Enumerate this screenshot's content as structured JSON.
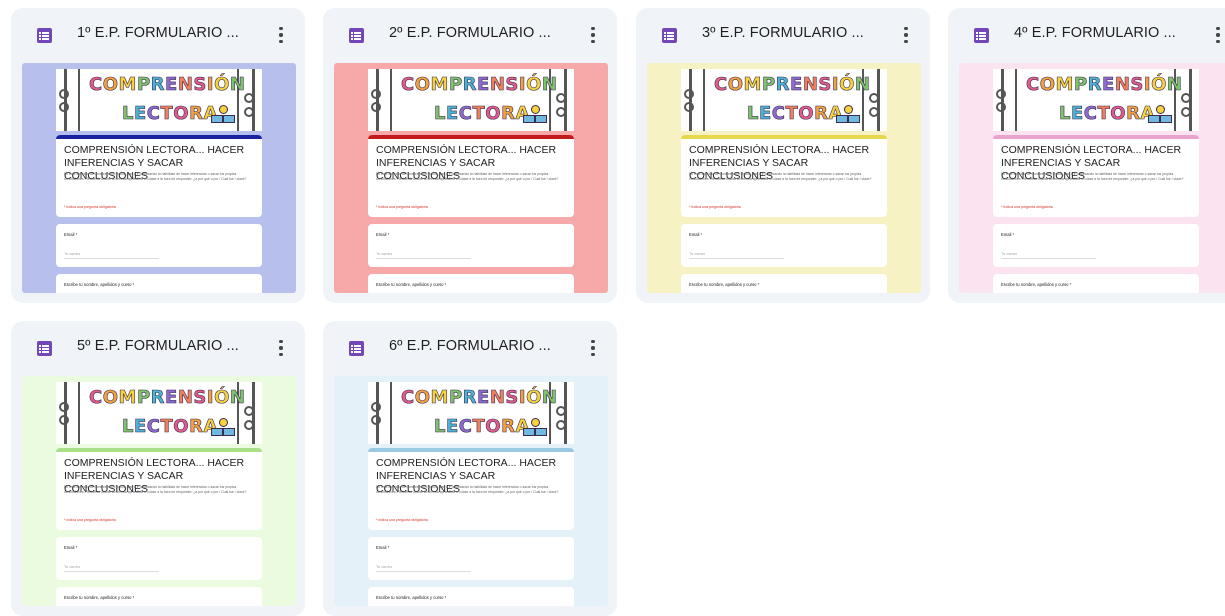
{
  "cards": [
    {
      "title": "1º E.P. FORMULARIO ...",
      "theme_bg": "#b7c0ec",
      "accent": "#1a22a0",
      "form": {
        "banner_word1": "COMPRENSIÓN",
        "banner_word2": "LECTORA",
        "heading": "COMPRENSIÓN LECTORA... HACER INFERENCIAS Y SACAR CONCLUSIONES",
        "description": "En este ejercicio de Comprensión lectora, vas a ir practicando la habilidad de hacer inferencias o sacar tus propias conclusiones. Recuerda utilizar la fórmula aprendida en clase a la hora de responder: ¿a por qué o por / Cuál fue / clave?",
        "required_note": "* Indica una pregunta obligatoria",
        "email_label": "Email *",
        "email_placeholder": "Tu correo",
        "name_label": "Escribe tu nombre, apellidos y curso *"
      }
    },
    {
      "title": "2º E.P. FORMULARIO ...",
      "theme_bg": "#f7a8a8",
      "accent": "#c21b1b",
      "form": {
        "banner_word1": "COMPRENSIÓN",
        "banner_word2": "LECTORA",
        "heading": "COMPRENSIÓN LECTORA... HACER INFERENCIAS Y SACAR CONCLUSIONES",
        "description": "En este ejercicio de Comprensión lectora, vas a ir practicando la habilidad de hacer inferencias o sacar tus propias conclusiones. Recuerda utilizar la fórmula aprendida en clase a la hora de responder: ¿a por qué o por / Cuál fue / clave?",
        "required_note": "* Indica una pregunta obligatoria",
        "email_label": "Email *",
        "email_placeholder": "Tu correo",
        "name_label": "Escribe tu nombre, apellidos y curso *"
      }
    },
    {
      "title": "3º E.P. FORMULARIO ...",
      "theme_bg": "#f7f2c4",
      "accent": "#e5d84a",
      "form": {
        "banner_word1": "COMPRENSIÓN",
        "banner_word2": "LECTORA",
        "heading": "COMPRENSIÓN LECTORA... HACER INFERENCIAS Y SACAR CONCLUSIONES",
        "description": "En este ejercicio de Comprensión lectora, vas a ir practicando la habilidad de hacer inferencias o sacar tus propias conclusiones. Recuerda utilizar la fórmula aprendida en clase a la hora de responder: ¿a por qué o por / Cuál fue / clave?",
        "required_note": "* Indica una pregunta obligatoria",
        "email_label": "Email *",
        "email_placeholder": "Tu correo",
        "name_label": "Escribe tu nombre, apellidos y curso *"
      }
    },
    {
      "title": "4º E.P. FORMULARIO ...",
      "theme_bg": "#fbe4f0",
      "accent": "#e9a3cf",
      "form": {
        "banner_word1": "COMPRENSIÓN",
        "banner_word2": "LECTORA",
        "heading": "COMPRENSIÓN LECTORA... HACER INFERENCIAS Y SACAR CONCLUSIONES",
        "description": "En este ejercicio de Comprensión lectora, vas a ir practicando la habilidad de hacer inferencias o sacar tus propias conclusiones. Recuerda utilizar la fórmula aprendida en clase a la hora de responder: ¿a por qué o por / Cuál fue / clave?",
        "required_note": "* Indica una pregunta obligatoria",
        "email_label": "Email *",
        "email_placeholder": "Tu correo",
        "name_label": "Escribe tu nombre, apellidos y curso *"
      }
    },
    {
      "title": "5º E.P. FORMULARIO ...",
      "theme_bg": "#eafbe0",
      "accent": "#a9df86",
      "form": {
        "banner_word1": "COMPRENSIÓN",
        "banner_word2": "LECTORA",
        "heading": "COMPRENSIÓN LECTORA... HACER INFERENCIAS Y SACAR CONCLUSIONES",
        "description": "En este ejercicio de Comprensión lectora, vas a ir practicando la habilidad de hacer inferencias o sacar tus propias conclusiones. Recuerda utilizar la fórmula aprendida en clase a la hora de responder: ¿a por qué o por / Cuál fue / clave?",
        "required_note": "* Indica una pregunta obligatoria",
        "email_label": "Email *",
        "email_placeholder": "Tu correo",
        "name_label": "Escribe tu nombre, apellidos y curso *"
      }
    },
    {
      "title": "6º E.P. FORMULARIO ...",
      "theme_bg": "#e4f1f8",
      "accent": "#9ac9e2",
      "form": {
        "banner_word1": "COMPRENSIÓN",
        "banner_word2": "LECTORA",
        "heading": "COMPRENSIÓN LECTORA... HACER INFERENCIAS Y SACAR CONCLUSIONES",
        "description": "En este ejercicio de Comprensión lectora, vas a ir practicando la habilidad de hacer inferencias o sacar tus propias conclusiones. Recuerda utilizar la fórmula aprendida en clase a la hora de responder: ¿a por qué o por / Cuál fue / clave?",
        "required_note": "* Indica una pregunta obligatoria",
        "email_label": "Email *",
        "email_placeholder": "Tu correo",
        "name_label": "Escribe tu nombre, apellidos y curso *"
      }
    }
  ],
  "icons": {
    "file_type": "google-forms-icon",
    "menu": "more-vert-icon"
  }
}
